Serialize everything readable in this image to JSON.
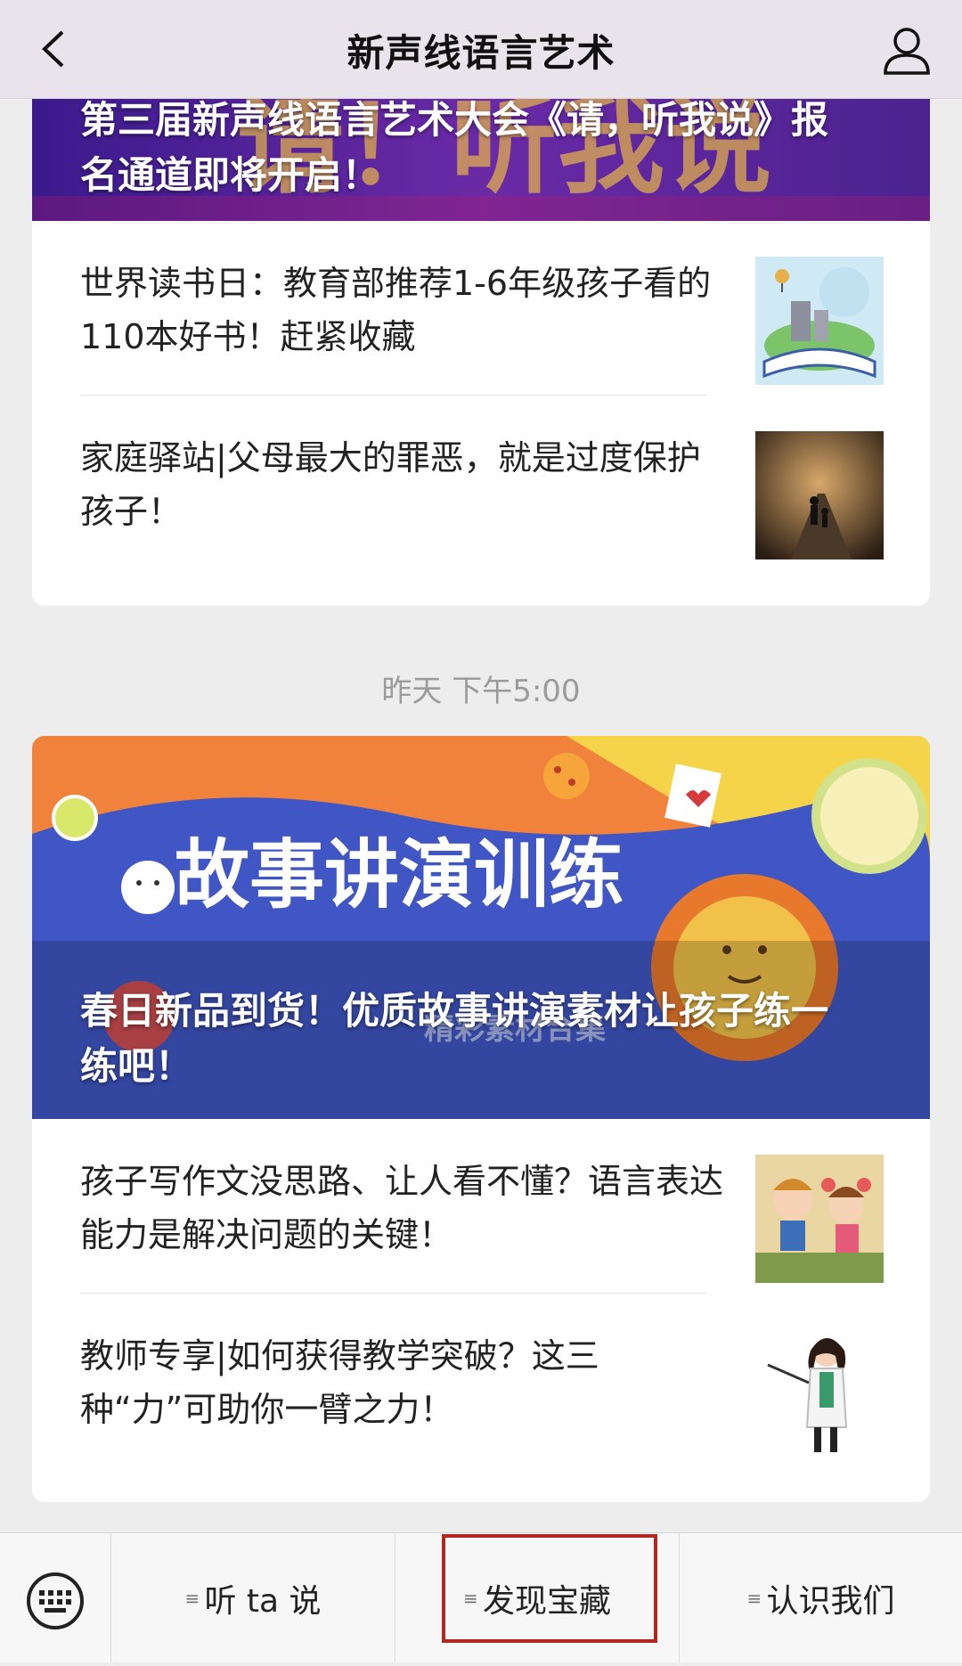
{
  "header": {
    "title": "新声线语言艺术"
  },
  "card1": {
    "banner_caption": "第三届新声线语言艺术大会《请，听我说》报名通道即将开启！",
    "articles": [
      {
        "title": "世界读书日：教育部推荐1-6年级孩子看的110本好书！赶紧收藏"
      },
      {
        "title": "家庭驿站|父母最大的罪恶，就是过度保护孩子！"
      }
    ]
  },
  "timestamp": "昨天 下午5:00",
  "card2": {
    "banner_title": "故事讲演训练",
    "banner_sub": "精彩素材合集",
    "banner_caption": "春日新品到货！优质故事讲演素材让孩子练一练吧！",
    "articles": [
      {
        "title": "孩子写作文没思路、让人看不懂？语言表达能力是解决问题的关键！"
      },
      {
        "title": "教师专享|如何获得教学突破？这三种“力”可助你一臂之力！"
      }
    ]
  },
  "menu": {
    "items": [
      {
        "label": "听 ta 说"
      },
      {
        "label": "发现宝藏"
      },
      {
        "label": "认识我们"
      }
    ]
  },
  "colors": {
    "header_bg": "#e9e3ec",
    "page_bg": "#ededed",
    "highlight": "#b3271e"
  }
}
